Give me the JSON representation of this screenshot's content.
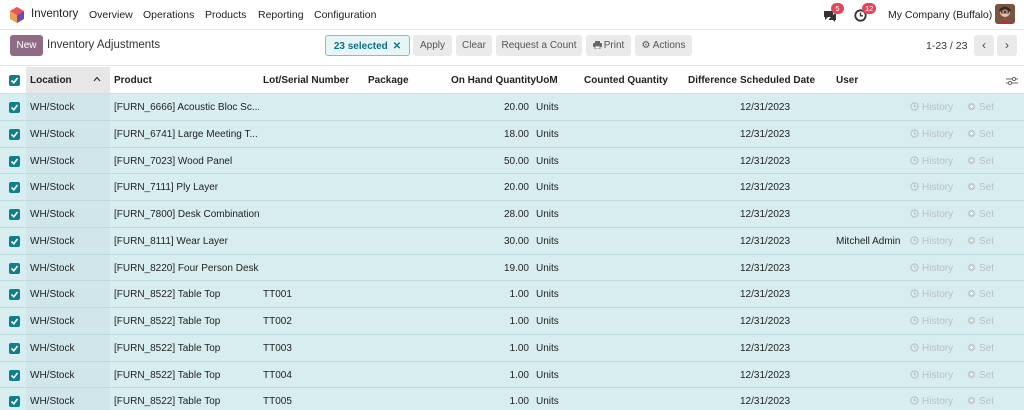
{
  "navbar": {
    "app_name": "Inventory",
    "menu": [
      "Overview",
      "Operations",
      "Products",
      "Reporting",
      "Configuration"
    ],
    "messages_badge": "5",
    "activities_badge": "12",
    "company": "My Company (Buffalo)"
  },
  "control_panel": {
    "new_label": "New",
    "title": "Inventory Adjustments",
    "selected_label": "23 selected",
    "apply_label": "Apply",
    "clear_label": "Clear",
    "request_count_label": "Request a Count",
    "print_label": "Print",
    "actions_label": "Actions",
    "pager": "1-23 / 23"
  },
  "table": {
    "columns": {
      "location": "Location",
      "product": "Product",
      "lot": "Lot/Serial Number",
      "package": "Package",
      "on_hand": "On Hand Quantity",
      "uom": "UoM",
      "counted": "Counted Quantity",
      "difference": "Difference",
      "scheduled": "Scheduled Date",
      "user": "User"
    },
    "history_label": "History",
    "set_label": "Set",
    "rows": [
      {
        "location": "WH/Stock",
        "product": "[FURN_6666] Acoustic Bloc Sc...",
        "lot": "",
        "on_hand": "20.00",
        "uom": "Units",
        "date": "12/31/2023",
        "user": ""
      },
      {
        "location": "WH/Stock",
        "product": "[FURN_6741] Large Meeting T...",
        "lot": "",
        "on_hand": "18.00",
        "uom": "Units",
        "date": "12/31/2023",
        "user": ""
      },
      {
        "location": "WH/Stock",
        "product": "[FURN_7023] Wood Panel",
        "lot": "",
        "on_hand": "50.00",
        "uom": "Units",
        "date": "12/31/2023",
        "user": ""
      },
      {
        "location": "WH/Stock",
        "product": "[FURN_7111] Ply Layer",
        "lot": "",
        "on_hand": "20.00",
        "uom": "Units",
        "date": "12/31/2023",
        "user": ""
      },
      {
        "location": "WH/Stock",
        "product": "[FURN_7800] Desk Combination",
        "lot": "",
        "on_hand": "28.00",
        "uom": "Units",
        "date": "12/31/2023",
        "user": ""
      },
      {
        "location": "WH/Stock",
        "product": "[FURN_8111] Wear Layer",
        "lot": "",
        "on_hand": "30.00",
        "uom": "Units",
        "date": "12/31/2023",
        "user": "Mitchell Admin"
      },
      {
        "location": "WH/Stock",
        "product": "[FURN_8220] Four Person Desk",
        "lot": "",
        "on_hand": "19.00",
        "uom": "Units",
        "date": "12/31/2023",
        "user": ""
      },
      {
        "location": "WH/Stock",
        "product": "[FURN_8522] Table Top",
        "lot": "TT001",
        "on_hand": "1.00",
        "uom": "Units",
        "date": "12/31/2023",
        "user": ""
      },
      {
        "location": "WH/Stock",
        "product": "[FURN_8522] Table Top",
        "lot": "TT002",
        "on_hand": "1.00",
        "uom": "Units",
        "date": "12/31/2023",
        "user": ""
      },
      {
        "location": "WH/Stock",
        "product": "[FURN_8522] Table Top",
        "lot": "TT003",
        "on_hand": "1.00",
        "uom": "Units",
        "date": "12/31/2023",
        "user": ""
      },
      {
        "location": "WH/Stock",
        "product": "[FURN_8522] Table Top",
        "lot": "TT004",
        "on_hand": "1.00",
        "uom": "Units",
        "date": "12/31/2023",
        "user": ""
      },
      {
        "location": "WH/Stock",
        "product": "[FURN_8522] Table Top",
        "lot": "TT005",
        "on_hand": "1.00",
        "uom": "Units",
        "date": "12/31/2023",
        "user": ""
      }
    ]
  }
}
